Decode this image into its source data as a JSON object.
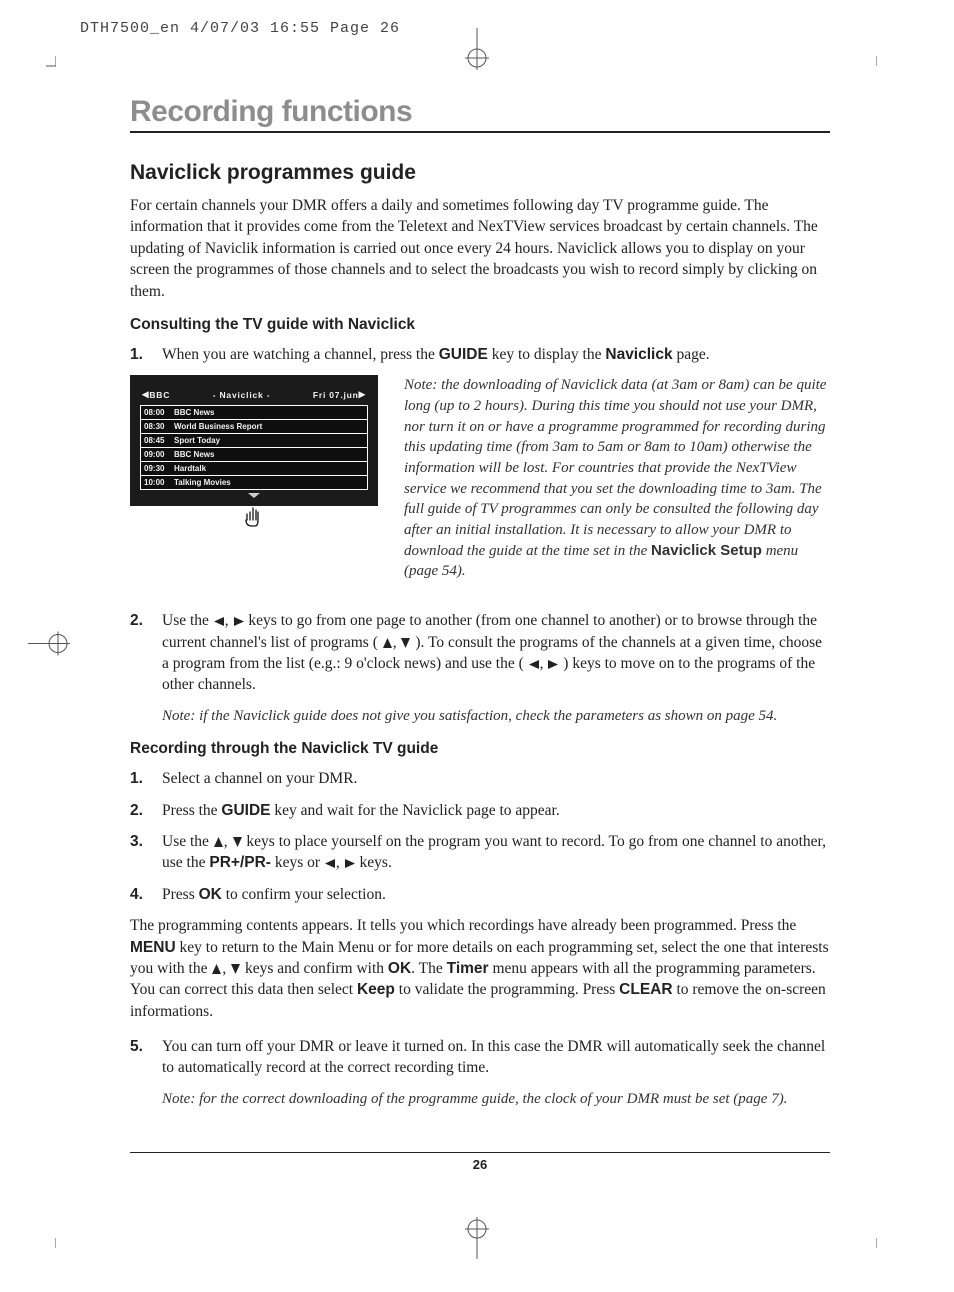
{
  "meta": {
    "slug": "DTH7500_en  4/07/03  16:55  Page 26"
  },
  "title": "Recording functions",
  "section": {
    "heading": "Naviclick programmes guide",
    "intro": "For certain channels your DMR offers a daily and sometimes following day TV programme guide. The information that it provides come from the Teletext and NexTView services broadcast by certain channels. The updating of Naviclik information is carried out once every 24 hours. Naviclick allows you to display on your screen the programmes of those channels and to select the broadcasts you wish to record simply by clicking on them.",
    "consult_heading": "Consulting the TV guide with Naviclick",
    "step1_pre": "When you are watching a channel, press the ",
    "step1_key": "GUIDE",
    "step1_mid": " key to display the ",
    "step1_key2": "Naviclick",
    "step1_post": " page.",
    "note1_pre": "Note: the downloading of Naviclick data (at 3am or 8am) can be quite long (up to 2 hours). During this time you should not use your DMR, nor turn it on or have a programme programmed for recording during this updating time (from 3am to 5am or 8am to 10am) otherwise the information will be lost. For countries that provide the NexTView service we recommend that you set the downloading time to 3am. The full guide of TV programmes can only be consulted the following day after an initial installation. It is necessary to allow your DMR to download the guide at the time set in the ",
    "note1_bold": "Naviclick Setup",
    "note1_post": " menu (page 54).",
    "step2_a": "Use the ",
    "step2_b": " keys to go from one page to another (from one channel to another) or to browse through the current channel's list of programs (",
    "step2_c": "). To consult the programs of the channels at a given time, choose a program from the list (e.g.: 9 o'clock news) and use the (",
    "step2_d": ") keys to move on to the programs of the other channels.",
    "note2": "Note: if the Naviclick guide does not give you satisfaction, check the parameters as shown on page 54.",
    "rec_heading": "Recording through the Naviclick TV guide",
    "rstep1": "Select a channel on your DMR.",
    "rstep2_a": "Press the ",
    "rstep2_key": "GUIDE",
    "rstep2_b": " key and wait for the Naviclick page to appear.",
    "rstep3_a": "Use the ",
    "rstep3_b": " keys to place yourself on the program you want to record. To go from one channel to another, use the ",
    "rstep3_key": "PR+/PR-",
    "rstep3_c": " keys or ",
    "rstep3_d": " keys.",
    "rstep4_a": "Press ",
    "rstep4_key": "OK",
    "rstep4_b": " to confirm your selection.",
    "para_a": "The programming contents appears. It tells you which recordings have already been programmed. Press the ",
    "para_k1": "MENU",
    "para_b": " key to return to the Main Menu or for more details on each programming set, select the one that interests you with the ",
    "para_c": " keys and confirm with ",
    "para_k2": "OK",
    "para_d": ". The ",
    "para_k3": "Timer",
    "para_e": " menu appears with all the programming parameters. You can correct this data then select ",
    "para_k4": "Keep",
    "para_f": " to validate the programming. Press ",
    "para_k5": "CLEAR",
    "para_g": " to remove the on-screen informations.",
    "rstep5": "You can turn off your DMR or leave it turned on. In this case the DMR will automatically seek the channel to automatically record at the correct recording time.",
    "note3": "Note: for the correct downloading of the programme guide, the clock of your DMR must be set (page 7)."
  },
  "screenshot": {
    "channel": "BBC",
    "title": "- Naviclick -",
    "date": "Fri 07.jun",
    "rows": [
      {
        "time": "08:00",
        "prog": "BBC News"
      },
      {
        "time": "08:30",
        "prog": "World Business Report"
      },
      {
        "time": "08:45",
        "prog": "Sport Today"
      },
      {
        "time": "09:00",
        "prog": "BBC News"
      },
      {
        "time": "09:30",
        "prog": "Hardtalk"
      },
      {
        "time": "10:00",
        "prog": "Talking Movies"
      }
    ]
  },
  "page_number": "26",
  "nums": {
    "n1": "1.",
    "n2": "2.",
    "n3": "3.",
    "n4": "4.",
    "n5": "5."
  }
}
